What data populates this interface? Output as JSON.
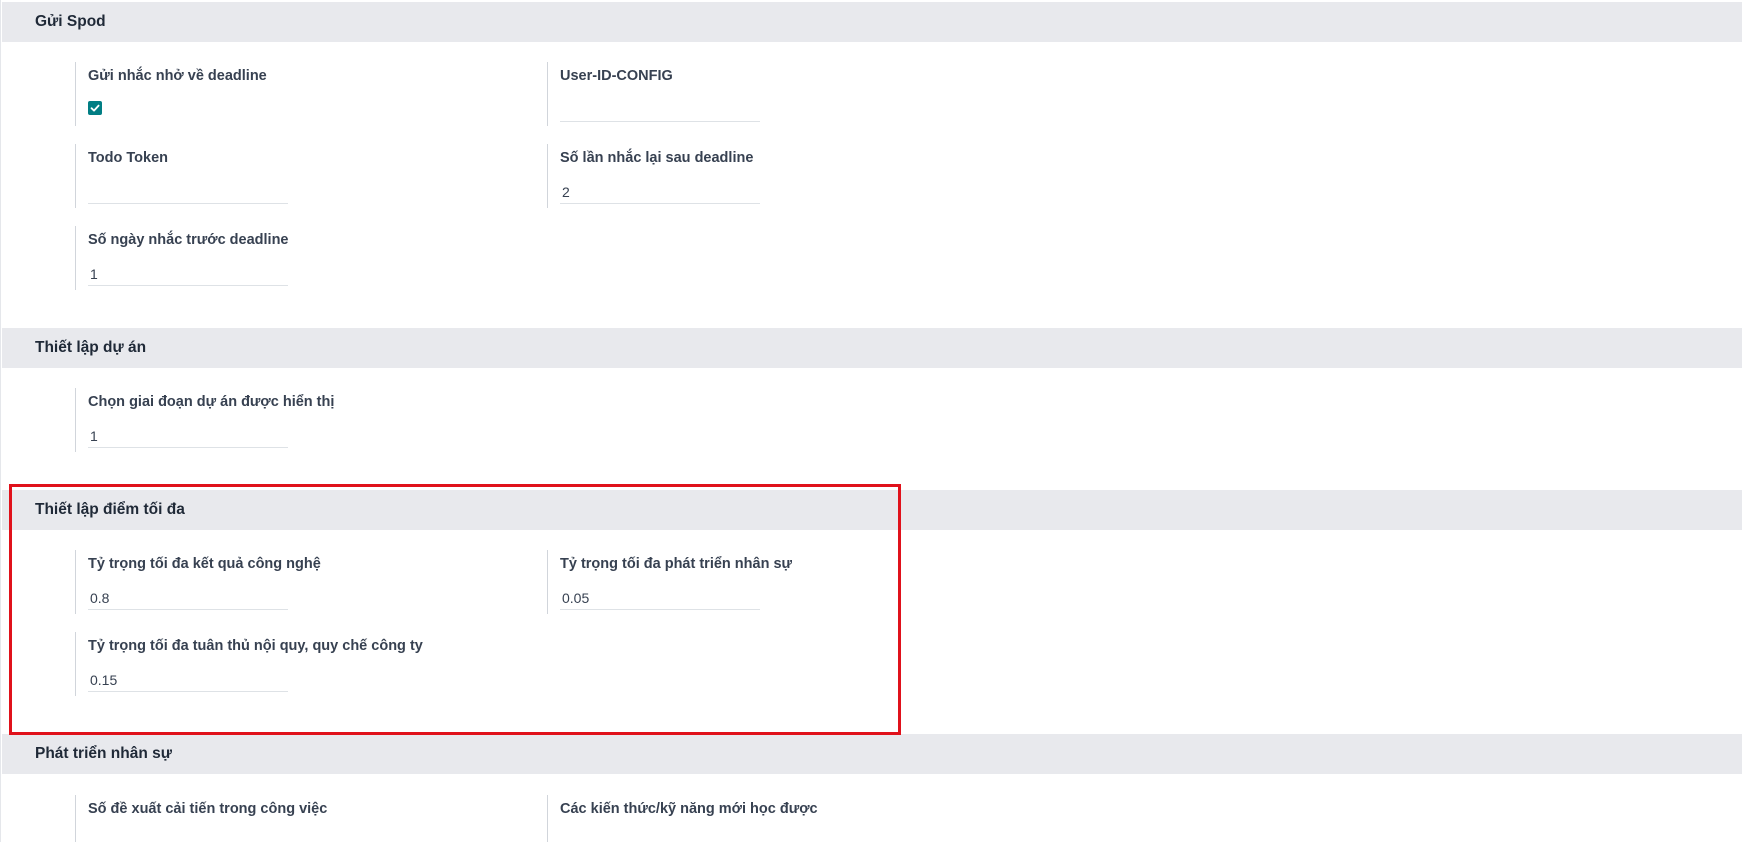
{
  "sections": {
    "send_spod": {
      "title": "Gửi Spod",
      "deadline_reminder_label": "Gửi nhắc nhở về deadline",
      "deadline_reminder_checked": true,
      "user_id_config_label": "User-ID-CONFIG",
      "user_id_config_value": "",
      "todo_token_label": "Todo Token",
      "todo_token_value": "",
      "repeat_after_deadline_label": "Số lần nhắc lại sau deadline",
      "repeat_after_deadline_value": "2",
      "days_before_deadline_label": "Số ngày nhắc trước deadline",
      "days_before_deadline_value": "1"
    },
    "project_settings": {
      "title": "Thiết lập dự án",
      "project_stage_label": "Chọn giai đoạn dự án được hiển thị",
      "project_stage_value": "1"
    },
    "max_score_settings": {
      "title": "Thiết lập điểm tối đa",
      "tech_result_weight_label": "Tỷ trọng tối đa kết quả công nghệ",
      "tech_result_weight_value": "0.8",
      "hr_development_weight_label": "Tỷ trọng tối đa phát triển nhân sự",
      "hr_development_weight_value": "0.05",
      "compliance_weight_label": "Tỷ trọng tối đa tuân thủ nội quy, quy chế công ty",
      "compliance_weight_value": "0.15"
    },
    "hr_development": {
      "title": "Phát triển nhân sự",
      "improvement_proposals_label": "Số đề xuất cải tiến trong công việc",
      "new_skills_label": "Các kiến thức/kỹ năng mới học được"
    }
  },
  "colors": {
    "checkbox": "#017e84",
    "section_header_bg": "#e8e9ed",
    "highlight": "#e0111b"
  }
}
